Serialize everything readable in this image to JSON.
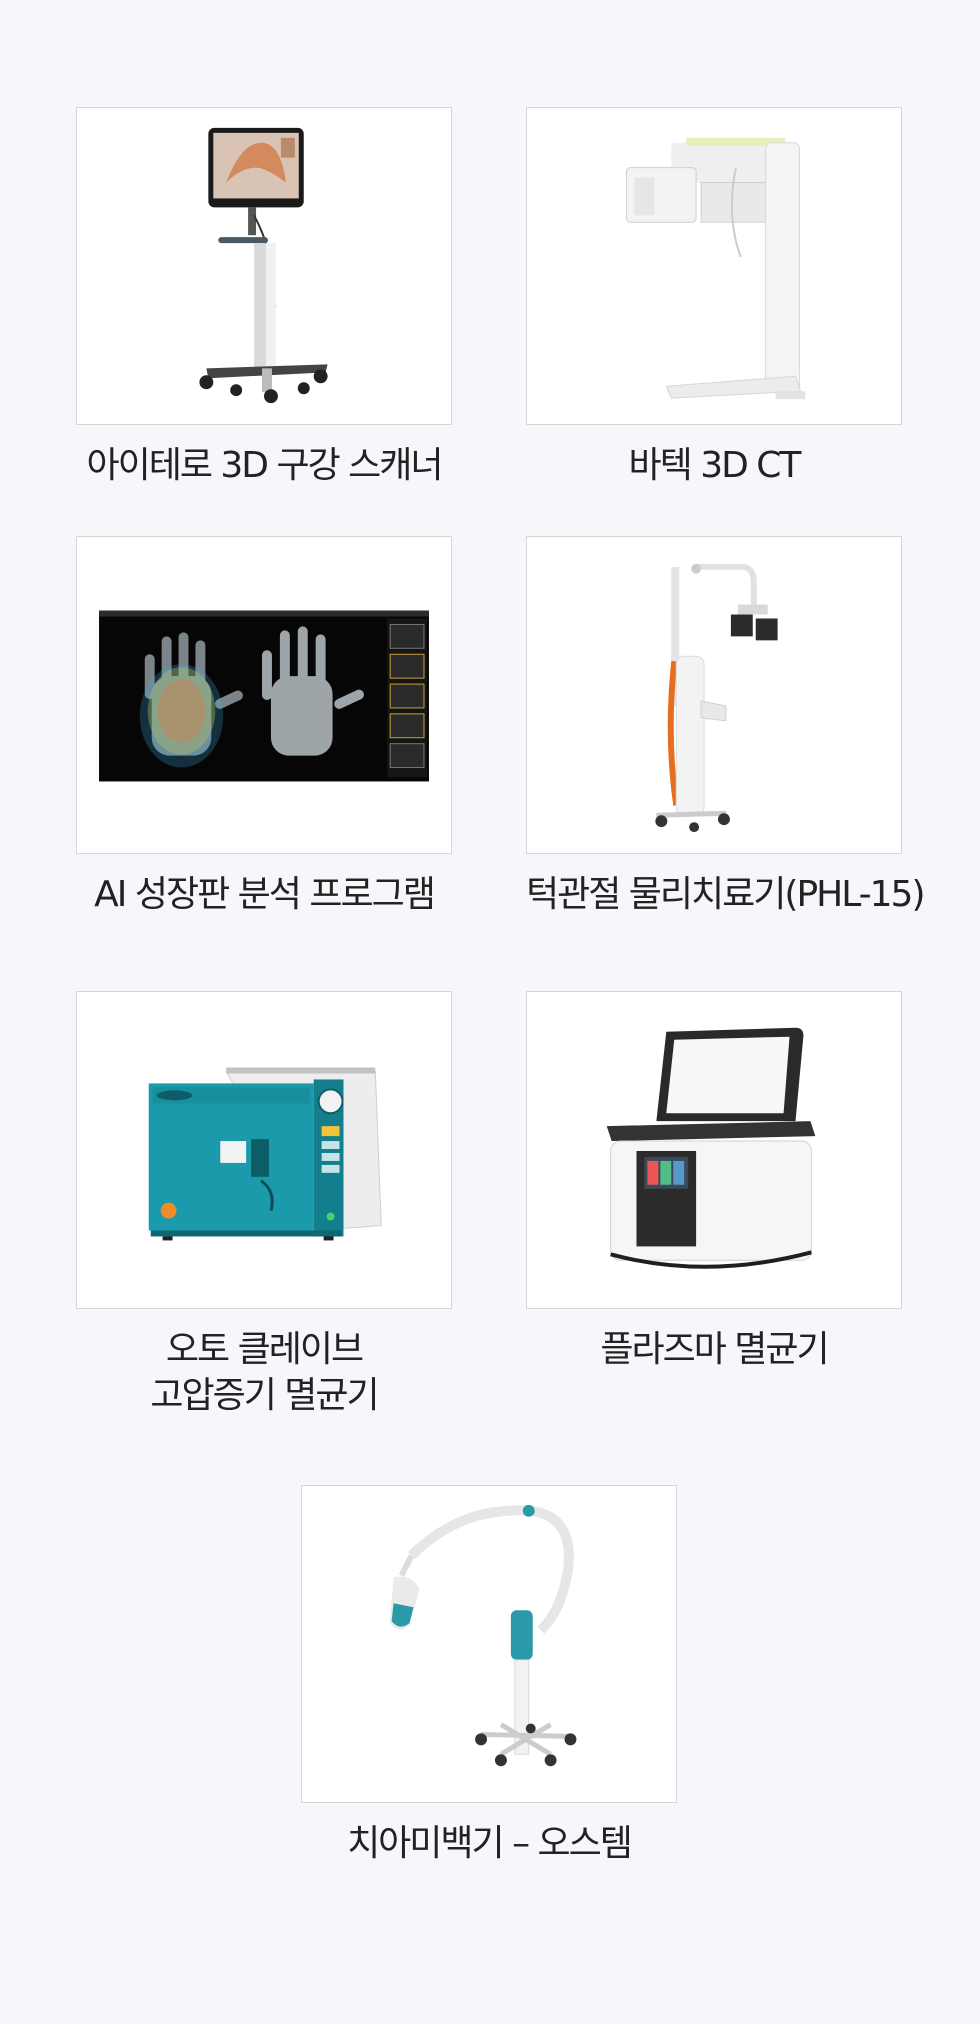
{
  "products": [
    {
      "caption": "아이테로 3D 구강 스캐너",
      "image_icon": "intraoral-scanner-icon"
    },
    {
      "caption": "바텍 3D CT",
      "image_icon": "cbct-xray-icon"
    },
    {
      "caption": "AI 성장판 분석 프로그램",
      "image_icon": "hand-xray-software-icon"
    },
    {
      "caption": "턱관절 물리치료기(PHL-15)",
      "image_icon": "tmj-therapy-device-icon"
    },
    {
      "caption_lines": [
        "오토 클레이브",
        "고압증기 멸균기"
      ],
      "image_icon": "autoclave-sterilizer-icon"
    },
    {
      "caption": "플라즈마 멸균기",
      "image_icon": "plasma-sterilizer-icon"
    },
    {
      "caption": "치아미백기 – 오스템",
      "image_icon": "teeth-whitening-lamp-icon"
    }
  ]
}
